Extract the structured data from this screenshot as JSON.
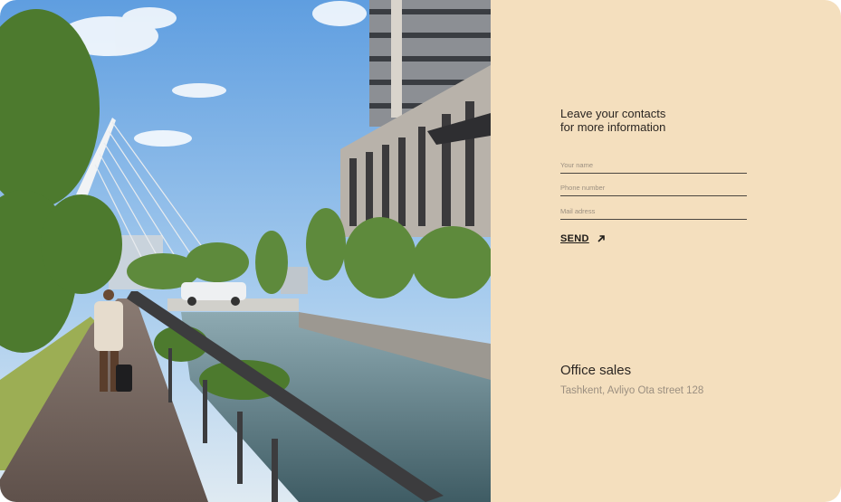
{
  "form": {
    "heading_line1": "Leave your contacts",
    "heading_line2": "for more information",
    "name_placeholder": "Your name",
    "phone_placeholder": "Phone number",
    "mail_placeholder": "Mail adress",
    "send_label": "SEND"
  },
  "office": {
    "title": "Office sales",
    "address": "Tashkent, Avliyo Ota street 128"
  },
  "colors": {
    "panel_background": "#f4dfbe",
    "text_dark": "#2b2622",
    "text_muted": "#9b8f80"
  },
  "icons": {
    "send": "arrow-up-right-icon"
  }
}
